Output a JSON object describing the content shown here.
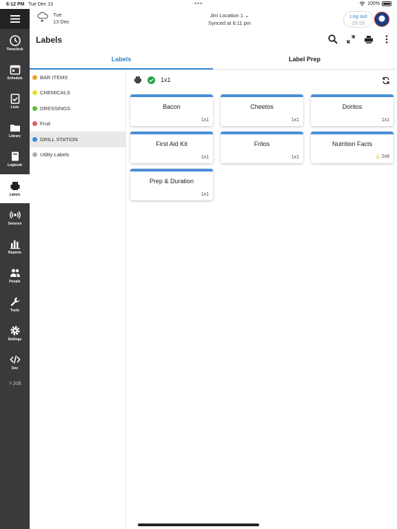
{
  "status_bar": {
    "time": "6:12 PM",
    "date": "Tue Dec 13",
    "battery": "100%"
  },
  "sidebar": {
    "items": [
      {
        "label": "Timeclock",
        "icon": "clock-icon"
      },
      {
        "label": "Schedule",
        "icon": "calendar-icon"
      },
      {
        "label": "Lists",
        "icon": "checklist-icon"
      },
      {
        "label": "Library",
        "icon": "folder-icon"
      },
      {
        "label": "Logbook",
        "icon": "book-icon"
      },
      {
        "label": "Labels",
        "icon": "printer-icon"
      },
      {
        "label": "Sensors",
        "icon": "sensor-icon"
      },
      {
        "label": "Reports",
        "icon": "bar-chart-icon"
      },
      {
        "label": "People",
        "icon": "people-icon"
      },
      {
        "label": "Tools",
        "icon": "wrench-icon"
      },
      {
        "label": "Settings",
        "icon": "gear-icon"
      },
      {
        "label": "Dev",
        "icon": "code-icon"
      }
    ],
    "brand": "Jolt"
  },
  "topbar": {
    "day": "Tue",
    "date": "13 Dec",
    "location": "Jim Location 1",
    "synced": "Synced at 6:11 pm",
    "logout": "Log out",
    "timer": "29:55"
  },
  "page": {
    "title": "Labels"
  },
  "tabs": [
    {
      "label": "Labels"
    },
    {
      "label": "Label Prep"
    }
  ],
  "categories": [
    {
      "name": "BAR ITEMS",
      "color": "#f0a030"
    },
    {
      "name": "CHEMICALS",
      "color": "#e8e030"
    },
    {
      "name": "DRESSINGS",
      "color": "#5cbf3a"
    },
    {
      "name": "Fruit",
      "color": "#e06060"
    },
    {
      "name": "GRILL STATION",
      "color": "#3a8fe0"
    },
    {
      "name": "Utility Labels",
      "color": "#b0b0b0"
    }
  ],
  "printer": {
    "size": "1x1"
  },
  "labels": [
    {
      "name": "Bacon",
      "size": "1x1"
    },
    {
      "name": "Cheetos",
      "size": "1x1"
    },
    {
      "name": "Doritos",
      "size": "1x1"
    },
    {
      "name": "First Aid Kit",
      "size": "1x1"
    },
    {
      "name": "Fritos",
      "size": "1x1"
    },
    {
      "name": "Nutrition Facts",
      "size": "2x6"
    },
    {
      "name": "Prep & Duration",
      "size": "1x1"
    }
  ]
}
